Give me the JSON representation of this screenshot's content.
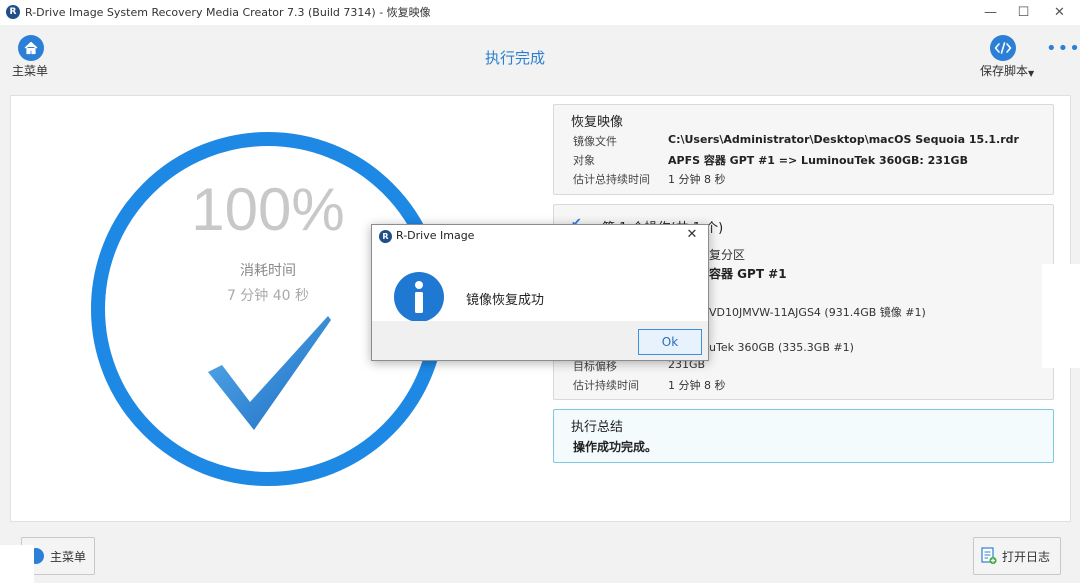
{
  "window": {
    "title": "R-Drive Image System Recovery Media Creator 7.3 (Build 7314) - 恢复映像",
    "logo_letter": "R",
    "minimize_glyph": "—",
    "maximize_glyph": "☐",
    "close_glyph": "✕"
  },
  "header": {
    "main_menu_label": "主菜单",
    "page_title": "执行完成",
    "save_script_label": "保存脚本",
    "more_glyph": "•••"
  },
  "progress": {
    "percent_text": "100%",
    "percent_value": 100,
    "elapsed_label": "消耗时间",
    "elapsed_value": "7 分钟 40 秒",
    "ring_color": "#1e88e5",
    "check_color": "#2f86d6"
  },
  "restore_card": {
    "title": "恢复映像",
    "rows": [
      {
        "label": "镜像文件",
        "value": "C:\\Users\\Administrator\\Desktop\\macOS Sequoia 15.1.rdr",
        "bold": true
      },
      {
        "label": "对象",
        "value": "APFS 容器 GPT #1  => LuminouTek 360GB: 231GB",
        "bold": true
      },
      {
        "label": "估计总持续时间",
        "value": "1 分钟 8 秒",
        "bold": false
      }
    ]
  },
  "operation_card": {
    "title": "第 1 个操作(共 1 个)",
    "rows": [
      {
        "label": "",
        "value": "复分区",
        "bold": false
      },
      {
        "label": "",
        "value": "容器 GPT #1",
        "bold": true
      },
      {
        "label": "",
        "value": "VD10JMVW-11AJGS4 (931.4GB 镜像 #1)",
        "bold": false
      },
      {
        "label": "",
        "value": "uTek 360GB (335.3GB #1)",
        "bold": false
      },
      {
        "label": "目标偏移",
        "value": "231GB",
        "bold": false
      },
      {
        "label": "估计持续时间",
        "value": "1 分钟 8 秒",
        "bold": false
      }
    ]
  },
  "summary_card": {
    "title": "执行总结",
    "message": "操作成功完成。"
  },
  "footer": {
    "main_menu_button": "主菜单",
    "open_log_button": "打开日志"
  },
  "dialog": {
    "title": "R-Drive Image",
    "close_glyph": "✕",
    "message": "镜像恢复成功",
    "ok_label": "Ok",
    "info_color": "#1f78d1"
  }
}
